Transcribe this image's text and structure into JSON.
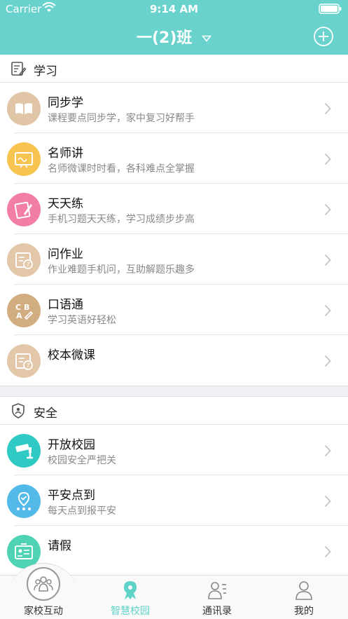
{
  "status": {
    "carrier": "Carrier",
    "time": "9:14 AM"
  },
  "nav": {
    "title": "一(2)班"
  },
  "sections": {
    "study": {
      "title": "学习",
      "items": [
        {
          "title": "同步学",
          "subtitle": "课程要点同步学，家中复习好帮手",
          "color": "#e0c6a6"
        },
        {
          "title": "名师讲",
          "subtitle": "名师微课时时看，各科难点全掌握",
          "color": "#f6c44f"
        },
        {
          "title": "天天练",
          "subtitle": "手机习题天天练，学习成绩步步高",
          "color": "#f27ea6"
        },
        {
          "title": "问作业",
          "subtitle": "作业难题手机问，互助解题乐趣多",
          "color": "#e2c7a8"
        },
        {
          "title": "口语通",
          "subtitle": "学习英语好轻松",
          "color": "#d3ad82"
        },
        {
          "title": "校本微课",
          "subtitle": "",
          "color": "#e2c7a8"
        }
      ]
    },
    "safety": {
      "title": "安全",
      "items": [
        {
          "title": "开放校园",
          "subtitle": "校园安全严把关",
          "color": "#2fcac3"
        },
        {
          "title": "平安点到",
          "subtitle": "每天点到报平安",
          "color": "#52b9e8"
        },
        {
          "title": "请假",
          "subtitle": "",
          "color": "#4fd3b4"
        }
      ]
    }
  },
  "tabs": [
    {
      "label": "家校互动",
      "icon": "group-icon"
    },
    {
      "label": "智慧校园",
      "icon": "campus-icon"
    },
    {
      "label": "通讯录",
      "icon": "contacts-icon"
    },
    {
      "label": "我的",
      "icon": "person-icon"
    }
  ],
  "colors": {
    "accent": "#69d2cc",
    "tab_active": "#5fd3c8"
  }
}
